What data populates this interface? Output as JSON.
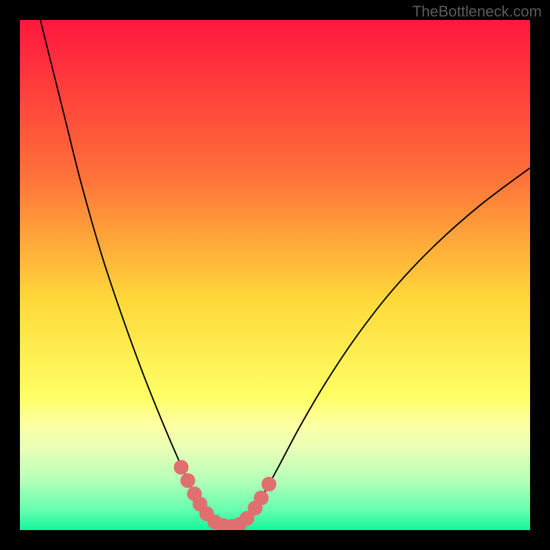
{
  "watermark": "TheBottleneck.com",
  "chart_data": {
    "type": "line",
    "title": "",
    "xlabel": "",
    "ylabel": "",
    "xlim": [
      0,
      100
    ],
    "ylim": [
      0,
      100
    ],
    "gradient_stops": [
      {
        "offset": 0,
        "color": "#ff173e"
      },
      {
        "offset": 30,
        "color": "#ff6f3a"
      },
      {
        "offset": 55,
        "color": "#ffd93a"
      },
      {
        "offset": 74,
        "color": "#ffff66"
      },
      {
        "offset": 79,
        "color": "#fdffa0"
      },
      {
        "offset": 84,
        "color": "#e9ffb8"
      },
      {
        "offset": 90,
        "color": "#b8ffb8"
      },
      {
        "offset": 96,
        "color": "#66ffb0"
      },
      {
        "offset": 100,
        "color": "#13f59b"
      }
    ],
    "series": [
      {
        "name": "curve",
        "stroke": "#000000",
        "points": [
          {
            "x": 4.0,
            "y": 100.0
          },
          {
            "x": 6.0,
            "y": 92.0
          },
          {
            "x": 9.0,
            "y": 80.0
          },
          {
            "x": 12.0,
            "y": 68.0
          },
          {
            "x": 16.0,
            "y": 54.0
          },
          {
            "x": 20.0,
            "y": 42.0
          },
          {
            "x": 24.0,
            "y": 31.0
          },
          {
            "x": 28.0,
            "y": 21.0
          },
          {
            "x": 31.0,
            "y": 14.0
          },
          {
            "x": 33.5,
            "y": 8.5
          },
          {
            "x": 36.0,
            "y": 4.0
          },
          {
            "x": 38.0,
            "y": 1.8
          },
          {
            "x": 40.0,
            "y": 0.8
          },
          {
            "x": 42.0,
            "y": 0.6
          },
          {
            "x": 43.5,
            "y": 1.2
          },
          {
            "x": 45.5,
            "y": 3.4
          },
          {
            "x": 48.0,
            "y": 7.5
          },
          {
            "x": 51.0,
            "y": 13.0
          },
          {
            "x": 55.0,
            "y": 20.5
          },
          {
            "x": 60.0,
            "y": 29.0
          },
          {
            "x": 66.0,
            "y": 38.0
          },
          {
            "x": 73.0,
            "y": 47.0
          },
          {
            "x": 81.0,
            "y": 55.5
          },
          {
            "x": 90.0,
            "y": 63.5
          },
          {
            "x": 100.0,
            "y": 71.0
          }
        ]
      }
    ],
    "markers": {
      "color": "#e07070",
      "radius_pct": 1.45,
      "points": [
        {
          "x": 31.6,
          "y": 12.3
        },
        {
          "x": 32.9,
          "y": 9.7
        },
        {
          "x": 34.2,
          "y": 7.1
        },
        {
          "x": 35.3,
          "y": 5.1
        },
        {
          "x": 36.6,
          "y": 3.2
        },
        {
          "x": 38.2,
          "y": 1.6
        },
        {
          "x": 39.8,
          "y": 0.9
        },
        {
          "x": 41.5,
          "y": 0.7
        },
        {
          "x": 43.0,
          "y": 1.1
        },
        {
          "x": 44.5,
          "y": 2.3
        },
        {
          "x": 46.1,
          "y": 4.3
        },
        {
          "x": 47.3,
          "y": 6.3
        },
        {
          "x": 48.8,
          "y": 9.0
        }
      ]
    }
  }
}
